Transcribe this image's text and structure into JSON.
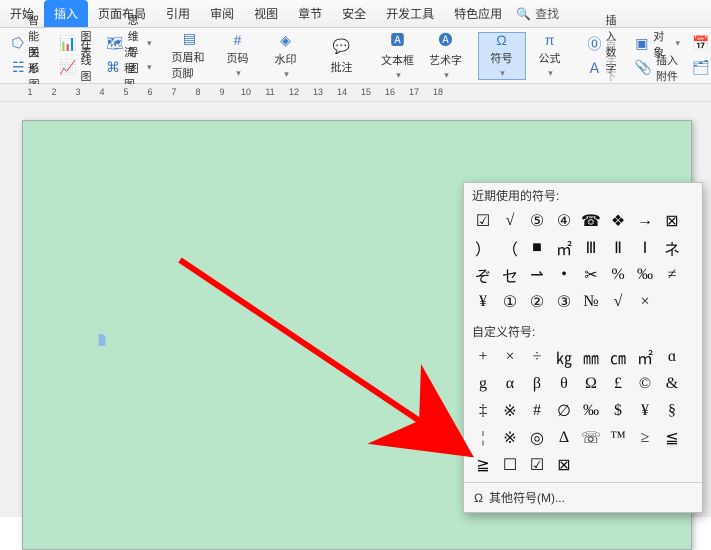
{
  "tabs": {
    "t0": "开始",
    "t1": "插入",
    "t2": "页面布局",
    "t3": "引用",
    "t4": "审阅",
    "t5": "视图",
    "t6": "章节",
    "t7": "安全",
    "t8": "开发工具",
    "t9": "特色应用"
  },
  "search": {
    "label": "查找"
  },
  "ribbon": {
    "group1": {
      "a": "智能图形",
      "b": "图表",
      "c": "思维导图",
      "d": "关系图",
      "e": "在线图表",
      "f": "流程图"
    },
    "group2": {
      "a": "页眉和页脚",
      "b": "页码",
      "c": "水印"
    },
    "group3": {
      "a": "批注"
    },
    "group4": {
      "a": "文本框",
      "b": "艺术字"
    },
    "group5": {
      "a": "符号",
      "b": "公式"
    },
    "group6": {
      "a": "插入数字",
      "b": "对象",
      "c": "日期",
      "d": "首字下沉",
      "e": "插入附件",
      "f": "文档部"
    }
  },
  "ruler_nums": [
    "1",
    "2",
    "3",
    "4",
    "5",
    "6",
    "7",
    "8",
    "9",
    "10",
    "11",
    "12",
    "13",
    "14",
    "15",
    "16",
    "17",
    "18"
  ],
  "dropdown": {
    "recent_label": "近期使用的符号:",
    "custom_label": "自定义符号:",
    "more_label": "其他符号(M)...",
    "more_icon": "Ω",
    "recent": [
      "☑",
      "√",
      "⑤",
      "④",
      "☎",
      "❖",
      "→",
      "⊠",
      "）",
      "（",
      "■",
      "㎡",
      "Ⅲ",
      "Ⅱ",
      "Ⅰ",
      "ネ",
      "ぞ",
      "セ",
      "⇀",
      "•",
      "✂",
      "%",
      "‰",
      "≠",
      "¥",
      "①",
      "②",
      "③",
      "№",
      "√",
      "×"
    ],
    "custom": [
      "+",
      "×",
      "÷",
      "㎏",
      "㎜",
      "㎝",
      "㎡",
      "ɑ",
      "g",
      "α",
      "β",
      "θ",
      "Ω",
      "£",
      "©",
      "&",
      "‡",
      "※",
      "#",
      "∅",
      "‰",
      "$",
      "¥",
      "§",
      "¦",
      "※",
      "◎",
      "Δ",
      "☏",
      "™",
      "≥",
      "≦",
      "≧",
      "☐",
      "☑",
      "⊠"
    ]
  }
}
